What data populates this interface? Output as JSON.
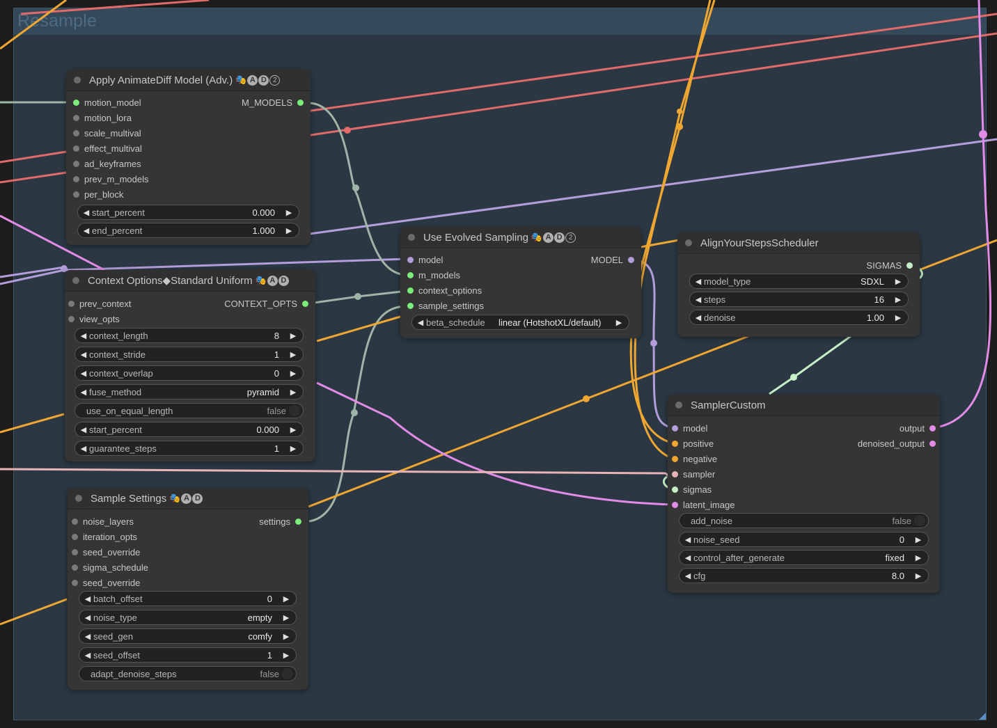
{
  "group": {
    "title": "Resample"
  },
  "colors": {
    "group_bg": "#2b3843",
    "group_header": "#34495a",
    "node_bg": "#353535",
    "wire_model": "#b39ddb",
    "wire_motion": "#9fb5a8",
    "wire_conditioning": "#f0a732",
    "wire_latent": "#e28ce8",
    "wire_clip": "#e26a6a",
    "wire_sigmas": "#c8f0c8",
    "wire_sampler": "#e8b4b8",
    "slot_green": "#7bed7b",
    "slot_grey": "#7a7a7a"
  },
  "badges": {
    "emoji": "🎭",
    "a": "A",
    "d": "D",
    "two": "2"
  },
  "nodes": {
    "apply_animatediff": {
      "title": "Apply AnimateDiff Model (Adv.)",
      "inputs": [
        "motion_model",
        "motion_lora",
        "scale_multival",
        "effect_multival",
        "ad_keyframes",
        "prev_m_models",
        "per_block"
      ],
      "output": "M_MODELS",
      "widgets": [
        {
          "label": "start_percent",
          "value": "0.000"
        },
        {
          "label": "end_percent",
          "value": "1.000"
        }
      ]
    },
    "context_options": {
      "title": "Context Options◆Standard Uniform",
      "inputs": [
        "prev_context",
        "view_opts"
      ],
      "output": "CONTEXT_OPTS",
      "widgets": [
        {
          "label": "context_length",
          "value": "8"
        },
        {
          "label": "context_stride",
          "value": "1"
        },
        {
          "label": "context_overlap",
          "value": "0"
        },
        {
          "label": "fuse_method",
          "value": "pyramid"
        },
        {
          "label": "use_on_equal_length",
          "value": "false"
        },
        {
          "label": "start_percent",
          "value": "0.000"
        },
        {
          "label": "guarantee_steps",
          "value": "1"
        }
      ]
    },
    "use_evolved_sampling": {
      "title": "Use Evolved Sampling",
      "inputs": [
        "model",
        "m_models",
        "context_options",
        "sample_settings"
      ],
      "output": "MODEL",
      "widgets": [
        {
          "label": "beta_schedule",
          "value": "linear (HotshotXL/default)"
        }
      ]
    },
    "align_your_steps": {
      "title": "AlignYourStepsScheduler",
      "output": "SIGMAS",
      "widgets": [
        {
          "label": "model_type",
          "value": "SDXL"
        },
        {
          "label": "steps",
          "value": "16"
        },
        {
          "label": "denoise",
          "value": "1.00"
        }
      ]
    },
    "sample_settings": {
      "title": "Sample Settings",
      "inputs": [
        "noise_layers",
        "iteration_opts",
        "seed_override",
        "sigma_schedule",
        "seed_override"
      ],
      "output": "settings",
      "widgets": [
        {
          "label": "batch_offset",
          "value": "0"
        },
        {
          "label": "noise_type",
          "value": "empty"
        },
        {
          "label": "seed_gen",
          "value": "comfy"
        },
        {
          "label": "seed_offset",
          "value": "1"
        },
        {
          "label": "adapt_denoise_steps",
          "value": "false"
        }
      ]
    },
    "sampler_custom": {
      "title": "SamplerCustom",
      "inputs": [
        "model",
        "positive",
        "negative",
        "sampler",
        "sigmas",
        "latent_image"
      ],
      "outputs": [
        "output",
        "denoised_output"
      ],
      "widgets": [
        {
          "label": "add_noise",
          "value": "false"
        },
        {
          "label": "noise_seed",
          "value": "0"
        },
        {
          "label": "control_after_generate",
          "value": "fixed"
        },
        {
          "label": "cfg",
          "value": "8.0"
        }
      ]
    }
  }
}
